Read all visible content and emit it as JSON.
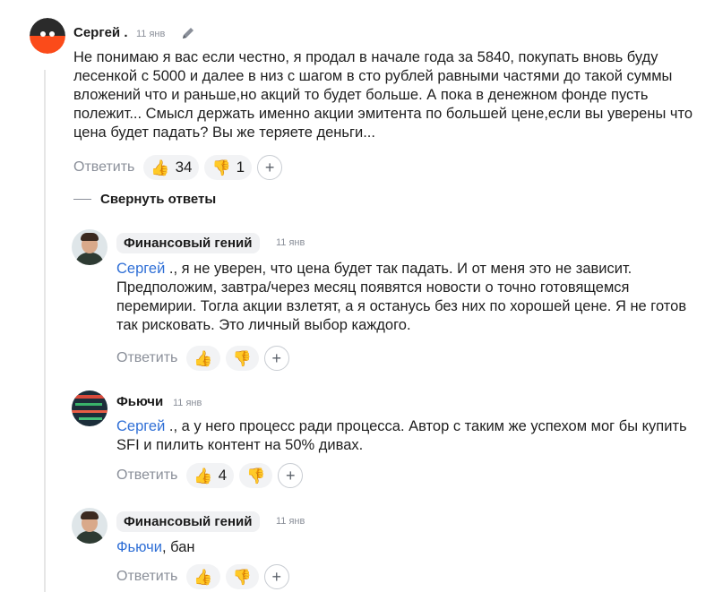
{
  "main_comment": {
    "author": "Сергей .",
    "date": "11 янв",
    "text": "Не понимаю я вас если честно, я продал в начале года за 5840, покупать вновь буду лесенкой с 5000 и далее в низ с шагом в сто рублей равными частями до такой суммы вложений что и раньше,но акций то будет больше. А пока в денежном фонде пусть полежит... Смысл держать именно акции эмитента по большей цене,если вы уверены что цена будет падать? Вы же теряете деньги...",
    "reply_label": "Ответить",
    "likes": "34",
    "dislikes": "1",
    "like_icon": "👍",
    "dislike_icon": "👎",
    "add_icon": "+",
    "edit_icon": "pencil-icon"
  },
  "collapse_label": "Свернуть ответы",
  "replies": [
    {
      "author": "Финансовый гений",
      "date": "11 янв",
      "mention": "Сергей",
      "text": " ., я не уверен, что цена будет так падать. И от меня это не зависит. Предположим, завтра/через месяц появятся новости о точно готовящемся перемирии. Тогла акции взлетят, а я останусь без них по хорошей цене. Я не готов так рисковать. Это личный выбор каждого.",
      "reply_label": "Ответить"
    },
    {
      "author": "Фьючи",
      "date": "11 янв",
      "mention": "Сергей",
      "text": " ., а у него процесс ради процесса. Автор с таким же успехом мог бы купить SFI и пилить контент на 50% дивах.",
      "reply_label": "Ответить",
      "likes": "4"
    },
    {
      "author": "Финансовый гений",
      "date": "11 янв",
      "mention": "Фьючи",
      "text": ", бан",
      "reply_label": "Ответить"
    }
  ],
  "colors": {
    "mention": "#2f6fd6",
    "muted": "#8a8f99",
    "reaction_bg": "#f2f3f5",
    "avatar_accent": "#fb4b1a"
  }
}
